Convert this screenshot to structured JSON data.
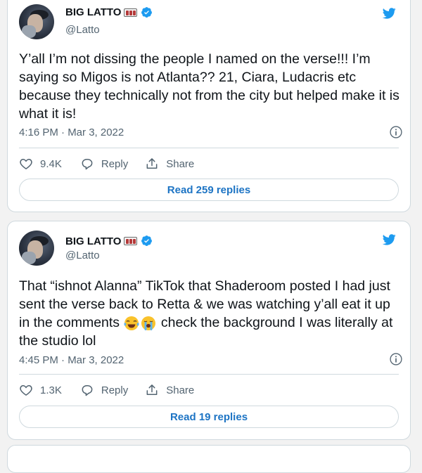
{
  "colors": {
    "accent": "#1d9bf0",
    "link": "#1d74c4",
    "secondary_text": "#536471",
    "border": "#cfd9de"
  },
  "tweets": [
    {
      "display_name": "BIG LATTO",
      "handle": "@Latto",
      "text": "Y’all I’m not dissing the people I named on the verse!!! I’m saying so Migos is not Atlanta?? 21, Ciara, Ludacris etc because they technically not from the city but helped make it is what it is!",
      "text_after_emoji": "",
      "emojis": [],
      "timestamp": "4:16 PM · Mar 3, 2022",
      "likes": "9.4K",
      "reply_label": "Reply",
      "share_label": "Share",
      "read_replies": "Read 259 replies"
    },
    {
      "display_name": "BIG LATTO",
      "handle": "@Latto",
      "text": "That “ishnot Alanna” TikTok that Shaderoom posted I had just sent the verse back to Retta & we was watching y’all eat it up in the comments",
      "text_after_emoji": "check the background I was literally at the studio lol",
      "emojis": [
        "face-with-tears-of-joy",
        "loudly-crying-face"
      ],
      "timestamp": "4:45 PM · Mar 3, 2022",
      "likes": "1.3K",
      "reply_label": "Reply",
      "share_label": "Share",
      "read_replies": "Read 19 replies"
    }
  ]
}
